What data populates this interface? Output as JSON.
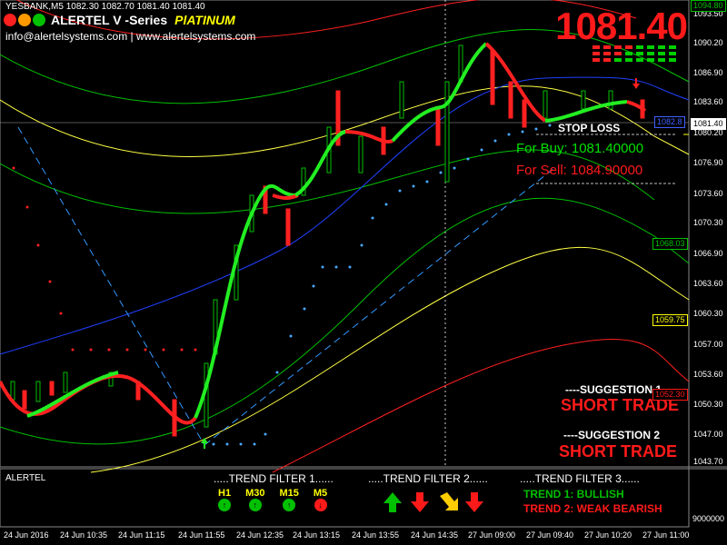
{
  "header": {
    "symbol_info": "YESBANK,M5  1082.30 1082.70 1081.40 1081.40",
    "brand": "ALERTEL V -Series",
    "tier": "PlATINUM",
    "contact": "info@alertelsystems.com | www.alertelsystems.com",
    "current_price": "1081.40",
    "dot_colors": [
      "#ff2020",
      "#ff9900",
      "#00c000"
    ]
  },
  "signals": {
    "stop_loss": "STOP LOSS",
    "for_buy": "For Buy: 1081.40000",
    "for_sell": "For Sell: 1084.90000",
    "suggestion_1_label": "----SUGGESTION 1",
    "suggestion_1_value": "SHORT TRADE",
    "suggestion_2_label": "----SUGGESTION 2",
    "suggestion_2_value": "SHORT TRADE"
  },
  "price_axis": {
    "labels": [
      "1093.50",
      "1090.20",
      "1086.90",
      "1083.60",
      "1080.20",
      "1076.90",
      "1073.60",
      "1070.30",
      "1066.90",
      "1063.60",
      "1060.30",
      "1057.00",
      "1053.60",
      "1050.30",
      "1047.00",
      "1043.70"
    ],
    "tags": [
      {
        "text": "1094.80",
        "color": "#00c000",
        "bg": "#000"
      },
      {
        "text": "1082.8",
        "color": "#4060ff",
        "bg": "#000"
      },
      {
        "text": "1081.40",
        "color": "#000",
        "bg": "#fff"
      },
      {
        "text": "1068.03",
        "color": "#00c000",
        "bg": "#000"
      },
      {
        "text": "1059.75",
        "color": "#ffff00",
        "bg": "#000"
      },
      {
        "text": "1052.30",
        "color": "#ff1a1a",
        "bg": "#000"
      }
    ]
  },
  "time_axis": [
    "24 Jun 2016",
    "24 Jun 10:35",
    "24 Jun 11:15",
    "24 Jun 11:55",
    "24 Jun 12:35",
    "24 Jun 13:15",
    "24 Jun 13:55",
    "24 Jun 14:35",
    "27 Jun 09:00",
    "27 Jun 09:40",
    "27 Jun 10:20",
    "27 Jun 11:00"
  ],
  "subwindow": {
    "title": "ALERTEL",
    "axis_label": "9000000",
    "trend_filter_1": ".....TREND FILTER 1......",
    "trend_filter_2": ".....TREND FILTER 2......",
    "trend_filter_3": ".....TREND FILTER 3......",
    "timeframes": [
      {
        "label": "H1",
        "icon": "up-circle-icon",
        "color": "#00c000"
      },
      {
        "label": "M30",
        "icon": "up-circle-icon",
        "color": "#00c000"
      },
      {
        "label": "M15",
        "icon": "up-circle-icon",
        "color": "#00c000"
      },
      {
        "label": "M5",
        "icon": "down-circle-icon",
        "color": "#ff1a1a"
      }
    ],
    "arrows": [
      {
        "icon": "arrow-up-icon",
        "color": "#00c000"
      },
      {
        "icon": "arrow-down-icon",
        "color": "#ff1a1a"
      },
      {
        "icon": "arrow-down-right-icon",
        "color": "#ffcc00"
      },
      {
        "icon": "arrow-down-icon",
        "color": "#ff1a1a"
      }
    ],
    "trend_1": "TREND 1:      BULLISH",
    "trend_2": "TREND 2: WEAK BEARISH"
  }
}
